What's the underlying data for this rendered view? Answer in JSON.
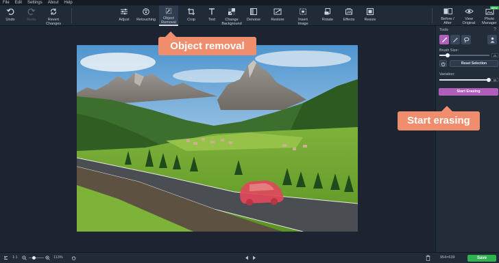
{
  "menu": [
    "File",
    "Edit",
    "Settings",
    "About",
    "Help"
  ],
  "toolbar": {
    "undo": "Undo",
    "redo": "Redo",
    "revert_line1": "Revert",
    "revert_line2": "Changes",
    "adjust": "Adjust",
    "retouching": "Retouching",
    "object_line1": "Object",
    "object_line2": "Removal",
    "crop": "Crop",
    "text": "Text",
    "change_bg_line1": "Change",
    "change_bg_line2": "Background",
    "denoise": "Denoise",
    "restore": "Restore",
    "insert_line1": "Insert",
    "insert_line2": "Image",
    "rotate": "Rotate",
    "effects": "Effects",
    "resize": "Resize",
    "before_after_line1": "Before /",
    "before_after_line2": "After",
    "view_original_line1": "View",
    "view_original_line2": "Original",
    "photo_manager_line1": "Photo",
    "photo_manager_line2": "Manager",
    "new_badge": "NEW"
  },
  "panel": {
    "title": "Tools",
    "help": "?",
    "brush_size_label": "Brush Size:",
    "brush_size_value": "25",
    "brush_size_fraction": 0.16,
    "reset_label": "Reset Selection",
    "variation_label": "Variation:",
    "variation_value": "99",
    "variation_fraction": 0.99,
    "start_label": "Start Erasing"
  },
  "bottom": {
    "ratio": "1:1",
    "zoom": "113%",
    "zoom_fraction": 0.35,
    "dimensions": "954×639",
    "save": "Save"
  },
  "callouts": {
    "object_removal": "Object removal",
    "start_erasing": "Start erasing"
  },
  "colors": {
    "accent_purple": "#b15fbd",
    "callout": "#f08d6c",
    "save_green": "#2fb34f"
  }
}
